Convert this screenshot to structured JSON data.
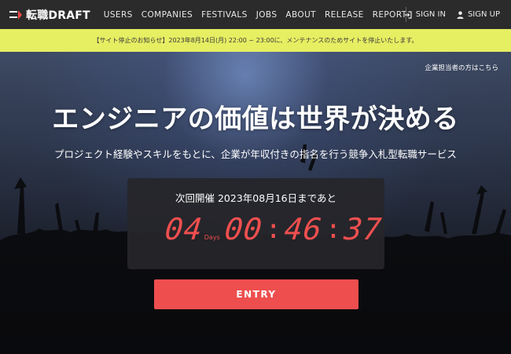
{
  "header": {
    "logo": {
      "jp": "転職",
      "en": "DRAFT"
    },
    "nav": [
      "USERS",
      "COMPANIES",
      "FESTIVALS",
      "JOBS",
      "ABOUT",
      "RELEASE",
      "REPORT"
    ],
    "sign_in": "SIGN IN",
    "sign_up": "SIGN UP"
  },
  "notice": {
    "text": "【サイト停止のお知らせ】2023年8月14日(月) 22:00 ~ 23:00に、メンテナンスのためサイトを停止いたします。"
  },
  "hero": {
    "employer_link": "企業担当者の方はこちら",
    "headline": "エンジニアの価値は世界が決める",
    "subhead": "プロジェクト経験やスキルをもとに、企業が年収付きの指名を行う競争入札型転職サービス"
  },
  "countdown": {
    "label": "次回開催 2023年08月16日まであと",
    "days": "04",
    "days_unit": "Days",
    "hours": "00",
    "minutes": "46",
    "seconds": "37"
  },
  "entry_button": "ENTRY",
  "colors": {
    "nav_bg": "#2b2b2b",
    "notice_bg": "#e6ee62",
    "accent_red": "#ee4e4e",
    "countdown_bg": "#26262a"
  },
  "icons": {
    "sign_in": "sign-in-icon",
    "sign_up": "user-icon",
    "logo": "draft-logo-mark"
  }
}
